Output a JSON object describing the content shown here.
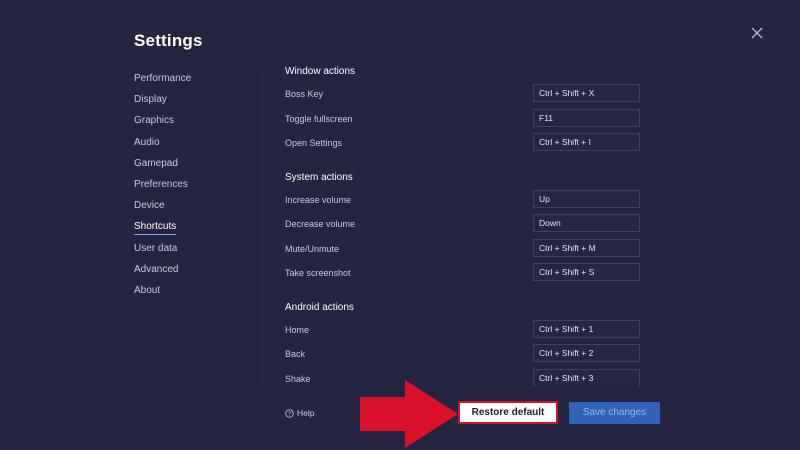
{
  "title": "Settings",
  "sidebar": {
    "items": [
      {
        "label": "Performance"
      },
      {
        "label": "Display"
      },
      {
        "label": "Graphics"
      },
      {
        "label": "Audio"
      },
      {
        "label": "Gamepad"
      },
      {
        "label": "Preferences"
      },
      {
        "label": "Device"
      },
      {
        "label": "Shortcuts"
      },
      {
        "label": "User data"
      },
      {
        "label": "Advanced"
      },
      {
        "label": "About"
      }
    ],
    "active": "Shortcuts"
  },
  "sections": [
    {
      "title": "Window actions",
      "rows": [
        {
          "label": "Boss Key",
          "value": "Ctrl + Shift + X"
        },
        {
          "label": "Toggle fullscreen",
          "value": "F11"
        },
        {
          "label": "Open Settings",
          "value": "Ctrl + Shift + I"
        }
      ]
    },
    {
      "title": "System actions",
      "rows": [
        {
          "label": "Increase volume",
          "value": "Up"
        },
        {
          "label": "Decrease volume",
          "value": "Down"
        },
        {
          "label": "Mute/Unmute",
          "value": "Ctrl + Shift + M"
        },
        {
          "label": "Take screenshot",
          "value": "Ctrl + Shift + S"
        }
      ]
    },
    {
      "title": "Android actions",
      "rows": [
        {
          "label": "Home",
          "value": "Ctrl + Shift + 1"
        },
        {
          "label": "Back",
          "value": "Ctrl + Shift + 2"
        },
        {
          "label": "Shake",
          "value": "Ctrl + Shift + 3"
        }
      ]
    }
  ],
  "footer": {
    "help_label": "Help",
    "restore_label": "Restore default",
    "save_label": "Save changes"
  },
  "colors": {
    "background": "#252542",
    "accent": "#2f62b8",
    "highlight": "#d3141f"
  },
  "icons": {
    "close": "close-icon",
    "help": "help-circle-icon",
    "annotation": "red-arrow-icon"
  }
}
